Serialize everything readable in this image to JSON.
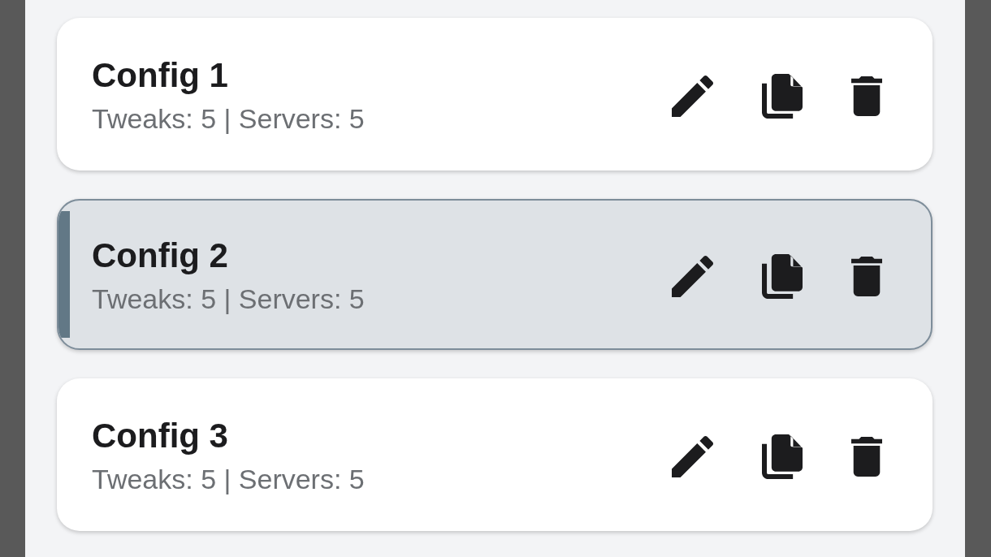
{
  "configs": [
    {
      "name": "Config 1",
      "details": "Tweaks: 5 | Servers: 5",
      "selected": false
    },
    {
      "name": "Config 2",
      "details": "Tweaks: 5 | Servers: 5",
      "selected": true
    },
    {
      "name": "Config 3",
      "details": "Tweaks: 5 | Servers: 5",
      "selected": false
    }
  ]
}
